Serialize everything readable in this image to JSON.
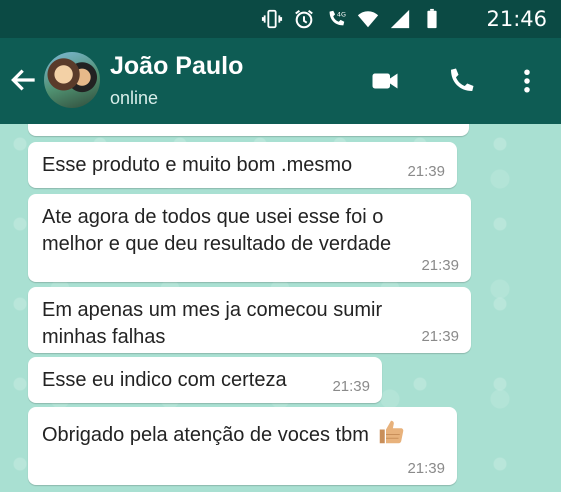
{
  "status_bar": {
    "time": "21:46",
    "icons": [
      "vibrate-icon",
      "alarm-icon",
      "4g-call-icon",
      "wifi-icon",
      "signal-icon",
      "battery-icon"
    ]
  },
  "header": {
    "contact_name": "João Paulo",
    "status": "online",
    "icons": [
      "back-arrow-icon",
      "video-call-icon",
      "phone-call-icon",
      "more-options-icon"
    ],
    "colors": {
      "status_bar": "#0b4a44",
      "app_bar": "#0e5c54"
    }
  },
  "chat": {
    "background": "#a9e0d2",
    "messages": [
      {
        "text": "Esse produto e muito bom .mesmo",
        "time": "21:39"
      },
      {
        "lines": [
          "Ate agora de todos que usei esse foi o",
          "melhor e que deu resultado de verdade"
        ],
        "time": "21:39"
      },
      {
        "lines": [
          "Em apenas um mes ja comecou sumir",
          "minhas falhas"
        ],
        "time": "21:39"
      },
      {
        "text": "Esse eu indico com certeza",
        "time": "21:39"
      },
      {
        "text": "Obrigado  pela atenção  de voces tbm",
        "emoji": "thumbs-up-icon",
        "time": "21:39"
      }
    ]
  }
}
